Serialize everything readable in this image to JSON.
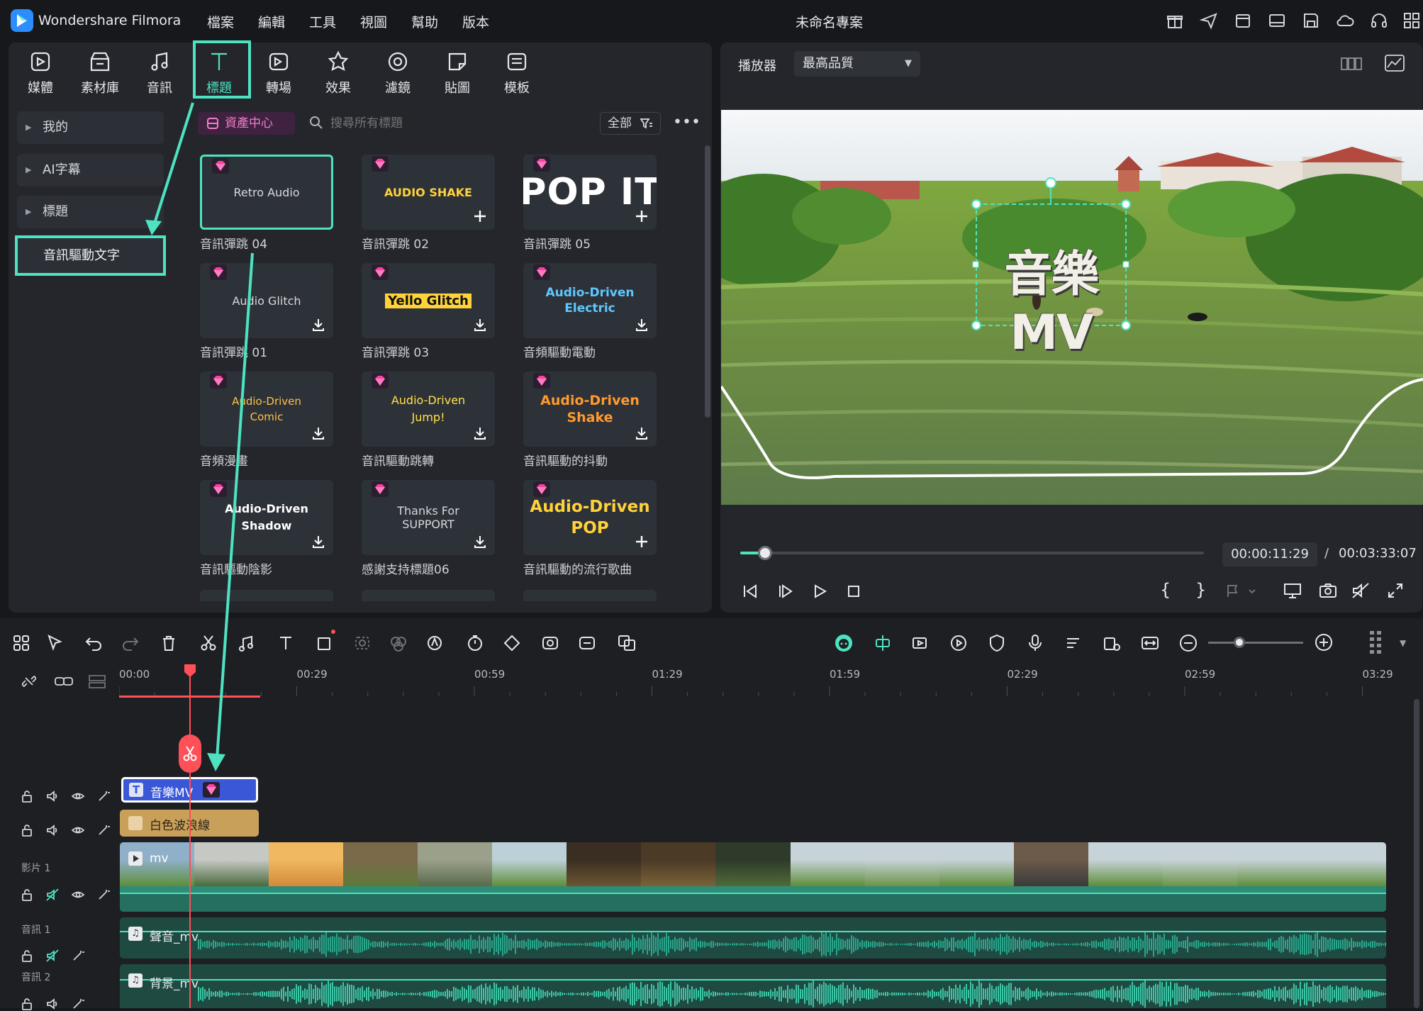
{
  "app": {
    "name": "Wondershare Filmora",
    "project_title": "未命名專案"
  },
  "menu": [
    "檔案",
    "編輯",
    "工具",
    "視圖",
    "幫助",
    "版本"
  ],
  "toolbar": [
    {
      "label": "媒體",
      "icon": "media-icon"
    },
    {
      "label": "素材庫",
      "icon": "stock-library-icon"
    },
    {
      "label": "音訊",
      "icon": "audio-note-icon"
    },
    {
      "label": "標題",
      "icon": "title-t-icon",
      "active": true
    },
    {
      "label": "轉場",
      "icon": "transition-icon"
    },
    {
      "label": "效果",
      "icon": "effects-icon"
    },
    {
      "label": "濾鏡",
      "icon": "filter-icon"
    },
    {
      "label": "貼圖",
      "icon": "sticker-icon"
    },
    {
      "label": "模板",
      "icon": "template-icon"
    }
  ],
  "sidebar": {
    "items": [
      {
        "label": "我的"
      },
      {
        "label": "AI字幕"
      },
      {
        "label": "標題"
      },
      {
        "label": "音訊驅動文字",
        "selected": true
      }
    ]
  },
  "library": {
    "asset_center_label": "資產中心",
    "search_placeholder": "搜尋所有標題",
    "filter_label": "全部",
    "cards": [
      {
        "preview": "Retro Audio",
        "label": "音訊彈跳 04",
        "action": "none",
        "selected": true
      },
      {
        "preview": "AUDIO SHAKE",
        "label": "音訊彈跳 02",
        "action": "add"
      },
      {
        "preview": "POP IT",
        "label": "音訊彈跳 05",
        "action": "add"
      },
      {
        "preview": "Audio Glitch",
        "label": "音訊彈跳 01",
        "action": "download"
      },
      {
        "preview": "Yello Glitch",
        "label": "音訊彈跳 03",
        "action": "download"
      },
      {
        "preview": "Audio-Driven Electric",
        "label": "音頻驅動電動",
        "action": "download"
      },
      {
        "preview": "Audio-Driven Comic",
        "label": "音頻漫畫",
        "action": "download"
      },
      {
        "preview": "Audio-Driven Jump!",
        "label": "音訊驅動跳轉",
        "action": "download"
      },
      {
        "preview": "Audio-Driven Shake",
        "label": "音訊驅動的抖動",
        "action": "download"
      },
      {
        "preview": "Audio-Driven Shadow",
        "label": "音訊驅動陰影",
        "action": "download"
      },
      {
        "preview": "Thanks For SUPPORT",
        "label": "感謝支持標題06",
        "action": "download"
      },
      {
        "preview": "Audio-Driven POP",
        "label": "音訊驅動的流行歌曲",
        "action": "add"
      }
    ]
  },
  "player": {
    "label": "播放器",
    "quality": "最高品質",
    "overlay_text": "音樂MV",
    "current_time": "00:00:11:29",
    "separator": "/",
    "total_time": "00:03:33:07",
    "progress": 0.054
  },
  "timeline": {
    "ruler_labels": [
      "00:00",
      "00:29",
      "00:59",
      "01:29",
      "01:59",
      "02:29",
      "02:59",
      "03:29"
    ],
    "tracks": [
      {
        "label": "",
        "clip": "音樂MV",
        "clip_type": "title"
      },
      {
        "label": "",
        "clip": "白色波浪線",
        "clip_type": "effect"
      },
      {
        "label": "影片 1",
        "clip": "mv",
        "clip_type": "video"
      },
      {
        "label": "音訊 1",
        "clip": "聲音_mv",
        "clip_type": "audio"
      },
      {
        "label": "音訊 2",
        "clip": "背景_mv",
        "clip_type": "audio"
      }
    ]
  },
  "colors": {
    "accent": "#4de3c1",
    "playhead": "#ff4f57",
    "title_clip": "#3a57d8",
    "effect_clip": "#c9a05a",
    "audio_wave": "#2aa68c"
  }
}
